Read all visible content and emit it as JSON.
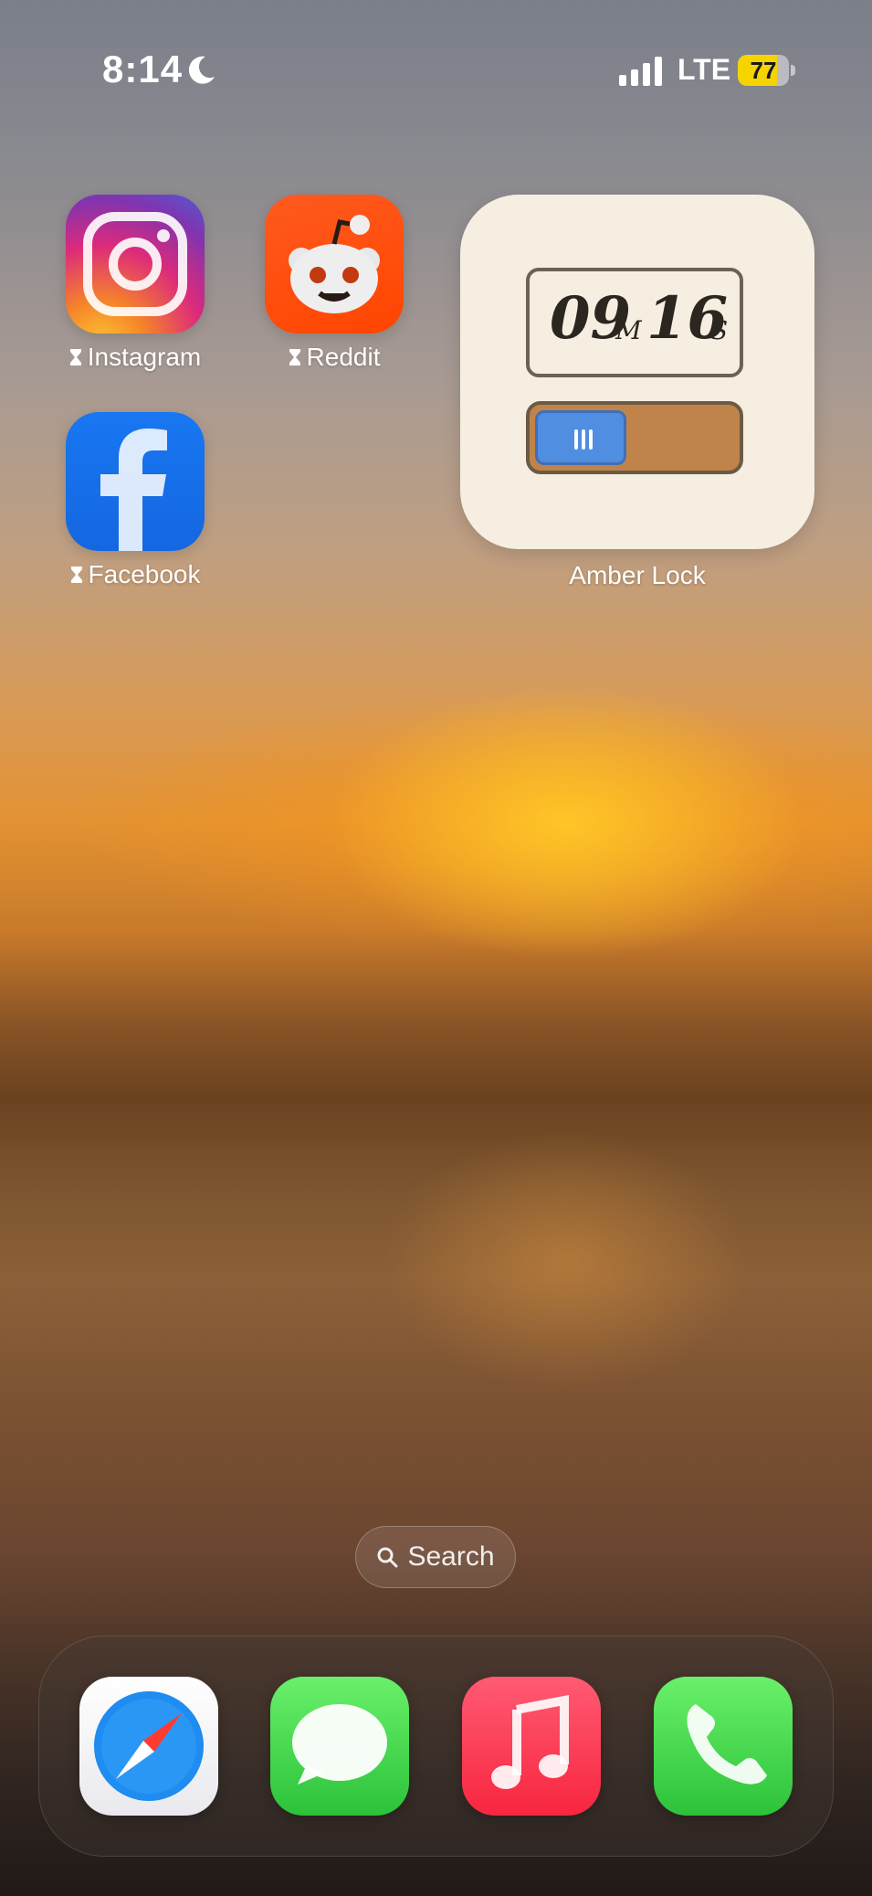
{
  "status_bar": {
    "time": "8:14",
    "focus_icon": "moon-icon",
    "signal_icon": "cellular-signal-icon",
    "network": "LTE",
    "battery_percent": "77",
    "battery_level": 0.77,
    "battery_color": "#f5d400"
  },
  "apps": [
    {
      "label": "Instagram",
      "icon": "instagram-icon",
      "limited": true
    },
    {
      "label": "Reddit",
      "icon": "reddit-icon",
      "limited": true
    },
    {
      "label": "Facebook",
      "icon": "facebook-icon",
      "limited": true
    }
  ],
  "widget": {
    "name": "Amber Lock",
    "minutes": "09",
    "minutes_unit": "M",
    "seconds": "16",
    "seconds_unit": "S"
  },
  "search": {
    "label": "Search",
    "icon": "search-icon"
  },
  "dock": [
    {
      "app": "Safari",
      "icon": "safari-icon"
    },
    {
      "app": "Messages",
      "icon": "messages-icon"
    },
    {
      "app": "Music",
      "icon": "music-icon"
    },
    {
      "app": "Phone",
      "icon": "phone-icon"
    }
  ]
}
